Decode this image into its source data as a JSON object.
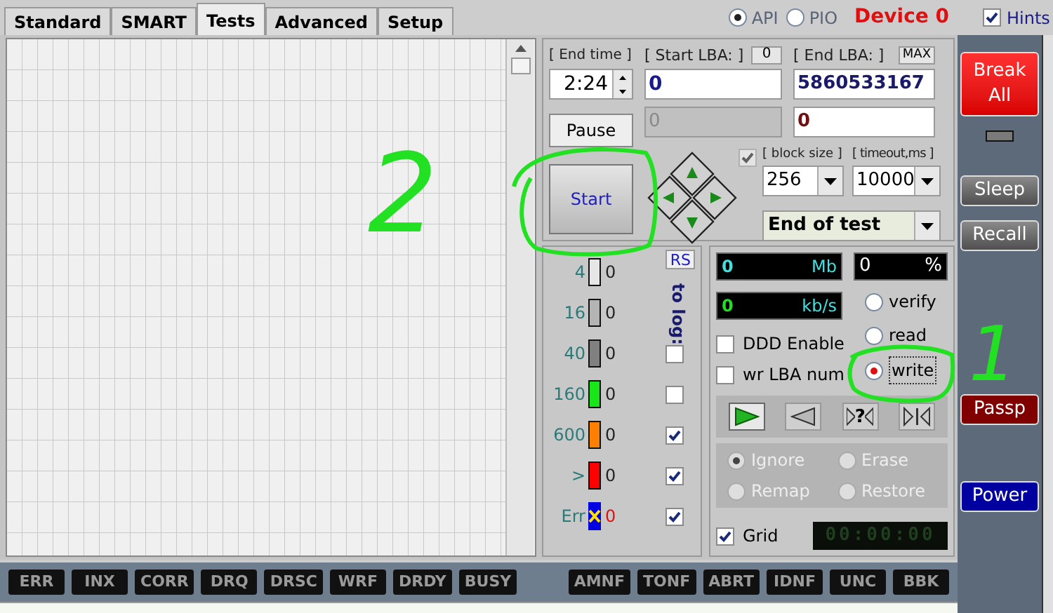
{
  "tabs": [
    {
      "label": "Standard",
      "selected": false
    },
    {
      "label": "SMART",
      "selected": false
    },
    {
      "label": "Tests",
      "selected": true
    },
    {
      "label": "Advanced",
      "selected": false
    },
    {
      "label": "Setup",
      "selected": false
    }
  ],
  "interface": [
    {
      "label": "API",
      "selected": true
    },
    {
      "label": "PIO",
      "selected": false
    }
  ],
  "device": "Device 0",
  "hints": {
    "label": "Hints",
    "checked": true
  },
  "test": {
    "end_time": {
      "label": "[ End time ]",
      "value": "2:24"
    },
    "start_lba": {
      "label": "[ Start LBA: ]",
      "button": "0",
      "value": "0",
      "current": "0"
    },
    "end_lba": {
      "label": "[ End LBA: ]",
      "button": "MAX",
      "value": "5860533167",
      "current": "0"
    },
    "pause_button": "Pause",
    "start_button": "Start",
    "direction_check": {
      "checked": true,
      "disabled": true
    },
    "block_size": {
      "label": "[ block size ]",
      "value": "256"
    },
    "timeout": {
      "label": "[ timeout,ms ]",
      "value": "10000"
    },
    "end_action": "End of test"
  },
  "legend": {
    "reset": "RS",
    "to_log": "to log:",
    "rows": [
      {
        "kind": "block",
        "label": "4",
        "color": "#e6e6e6",
        "count": "0"
      },
      {
        "kind": "block",
        "label": "16",
        "color": "#b4b4b4",
        "count": "0"
      },
      {
        "kind": "block",
        "label": "40",
        "color": "#808080",
        "count": "0",
        "logged": false
      },
      {
        "kind": "block",
        "label": "160",
        "color": "#19e619",
        "count": "0",
        "logged": false
      },
      {
        "kind": "block",
        "label": "600",
        "color": "#ff8000",
        "count": "0",
        "logged": true
      },
      {
        "kind": "block",
        "label": ">",
        "color": "#ff0000",
        "count": "0",
        "logged": true
      },
      {
        "kind": "error",
        "label": "Err",
        "count": "0",
        "logged": true
      }
    ]
  },
  "stats": {
    "mb": {
      "value": "0",
      "unit": "Mb"
    },
    "percent": {
      "value": "0",
      "unit": "%"
    },
    "speed": {
      "value": "0",
      "unit": "kb/s"
    }
  },
  "modes": [
    {
      "label": "verify",
      "selected": false
    },
    {
      "label": "read",
      "selected": false
    },
    {
      "label": "write",
      "selected": true
    }
  ],
  "options": [
    {
      "label": "DDD Enable",
      "checked": false
    },
    {
      "label": "wr LBA num",
      "checked": false
    }
  ],
  "transport": [
    {
      "kind": "play",
      "selected": true
    },
    {
      "kind": "back",
      "selected": false
    },
    {
      "kind": "random",
      "label": "?",
      "selected": false
    },
    {
      "kind": "butterfly",
      "selected": false
    }
  ],
  "repair": {
    "disabled": true,
    "options": [
      {
        "label": "Ignore",
        "selected": true
      },
      {
        "label": "Erase",
        "selected": false
      },
      {
        "label": "Remap",
        "selected": false
      },
      {
        "label": "Restore",
        "selected": false
      }
    ]
  },
  "grid": {
    "label": "Grid",
    "checked": true
  },
  "timer": "00:00:00",
  "sidebar": [
    {
      "kind": "danger",
      "label": "Break All"
    },
    {
      "kind": "indicator"
    },
    {
      "kind": "normal",
      "label": "Sleep"
    },
    {
      "kind": "normal",
      "label": "Recall"
    },
    {
      "kind": "dark",
      "label": "Passp"
    },
    {
      "kind": "blue",
      "label": "Power"
    }
  ],
  "flags_left": [
    "ERR",
    "INX",
    "CORR",
    "DRQ",
    "DRSC",
    "WRF",
    "DRDY",
    "BUSY"
  ],
  "flags_right": [
    "AMNF",
    "TONF",
    "ABRT",
    "IDNF",
    "UNC",
    "BBK"
  ],
  "annotations": [
    "2",
    "1"
  ]
}
